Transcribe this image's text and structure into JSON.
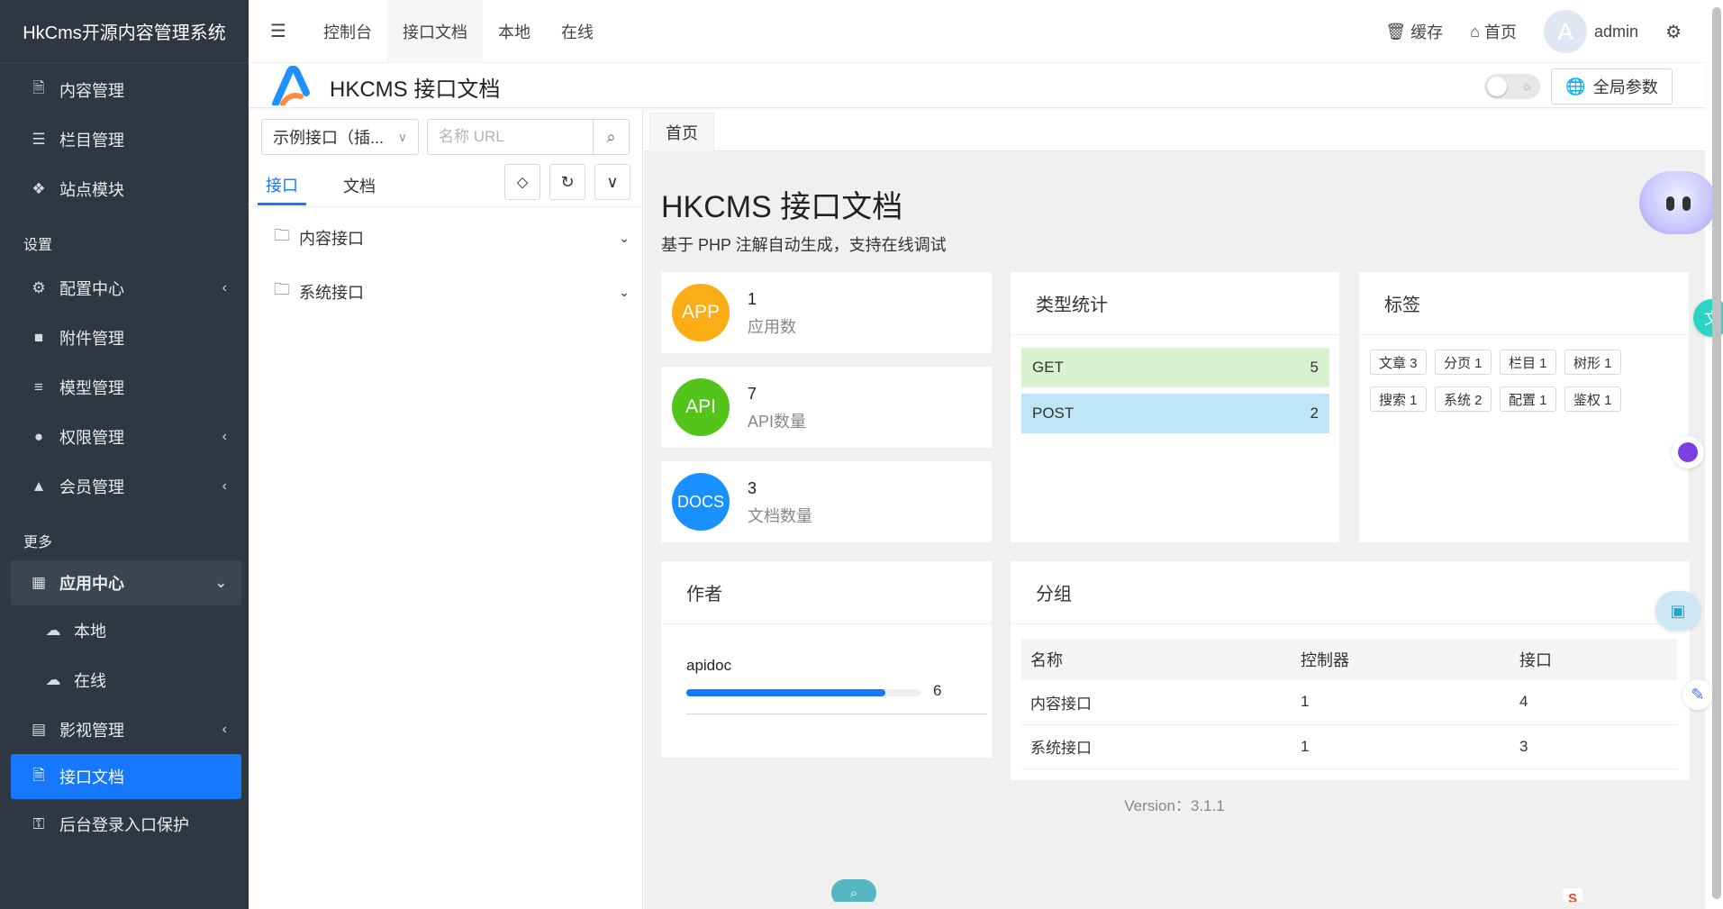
{
  "sidebar": {
    "brand": "HkCms开源内容管理系统",
    "items_top": [
      {
        "label": "内容管理",
        "icon": "file-icon"
      },
      {
        "label": "栏目管理",
        "icon": "list-icon"
      },
      {
        "label": "站点模块",
        "icon": "cubes-icon"
      }
    ],
    "section_settings": "设置",
    "items_settings": [
      {
        "label": "配置中心",
        "icon": "gear-icon",
        "has_arrow": true
      },
      {
        "label": "附件管理",
        "icon": "folder-icon",
        "has_arrow": false
      },
      {
        "label": "模型管理",
        "icon": "database-icon",
        "has_arrow": false
      },
      {
        "label": "权限管理",
        "icon": "user-icon",
        "has_arrow": true
      },
      {
        "label": "会员管理",
        "icon": "user-tie-icon",
        "has_arrow": true
      }
    ],
    "section_more": "更多",
    "app_center": "应用中心",
    "app_children": [
      {
        "label": "本地",
        "icon": "cloud-download-icon"
      },
      {
        "label": "在线",
        "icon": "cloud-icon"
      }
    ],
    "video": "影视管理",
    "api_doc": "接口文档",
    "login_protect": "后台登录入口保护"
  },
  "topbar": {
    "tabs": [
      "控制台",
      "接口文档",
      "本地",
      "在线"
    ],
    "active_tab": "接口文档",
    "cache": "缓存",
    "home": "首页",
    "avatar_letter": "A",
    "user": "admin"
  },
  "doc_header": {
    "title": "HKCMS 接口文档",
    "global_params": "全局参数"
  },
  "left_panel": {
    "select_value": "示例接口（插...",
    "search_placeholder": "名称 URL",
    "tab_api": "接口",
    "tab_docs": "文档",
    "groups": [
      "内容接口",
      "系统接口"
    ]
  },
  "main": {
    "crumb": "首页",
    "title": "HKCMS 接口文档",
    "subtitle": "基于 PHP 注解自动生成，支持在线调试",
    "stats": [
      {
        "badge": "APP",
        "value": "1",
        "label": "应用数",
        "color": "#faad14"
      },
      {
        "badge": "API",
        "value": "7",
        "label": "API数量",
        "color": "#52c41a"
      },
      {
        "badge": "DOCS",
        "value": "3",
        "label": "文档数量",
        "color": "#1890ff"
      }
    ],
    "type_stats": {
      "title": "类型统计",
      "rows": [
        {
          "method": "GET",
          "count": "5",
          "color": "#d9f2d0"
        },
        {
          "method": "POST",
          "count": "2",
          "color": "#bfe6f7"
        }
      ]
    },
    "tags": {
      "title": "标签",
      "items": [
        "文章 3",
        "分页 1",
        "栏目 1",
        "树形 1",
        "搜索 1",
        "系统 2",
        "配置 1",
        "鉴权 1"
      ]
    },
    "author": {
      "title": "作者",
      "name": "apidoc",
      "count": "6",
      "progress": 0.85
    },
    "groups": {
      "title": "分组",
      "columns": [
        "名称",
        "控制器",
        "接口"
      ],
      "rows": [
        [
          "内容接口",
          "1",
          "4"
        ],
        [
          "系统接口",
          "1",
          "3"
        ]
      ]
    },
    "version": "Version：3.1.1"
  }
}
